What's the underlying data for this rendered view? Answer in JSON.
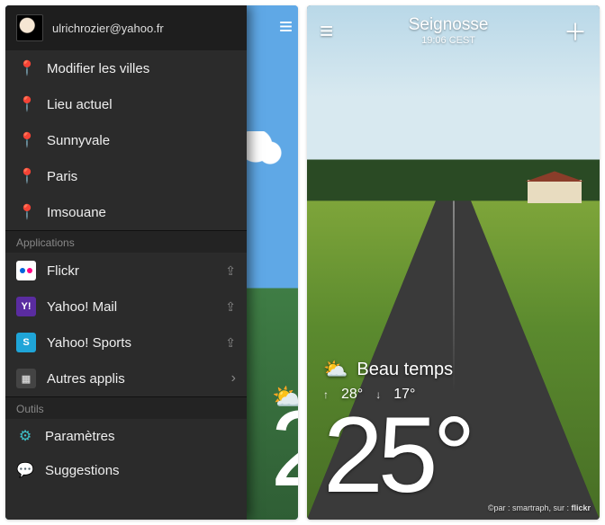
{
  "user": {
    "email": "ulrichrozier@yahoo.fr"
  },
  "locations": {
    "edit_label": "Modifier les villes",
    "items": [
      {
        "label": "Lieu actuel"
      },
      {
        "label": "Sunnyvale"
      },
      {
        "label": "Paris"
      },
      {
        "label": "Imsouane"
      }
    ]
  },
  "sections": {
    "apps_header": "Applications",
    "tools_header": "Outils"
  },
  "apps": [
    {
      "label": "Flickr",
      "icon": "flickr",
      "trailing": "download"
    },
    {
      "label": "Yahoo! Mail",
      "icon": "ymail",
      "trailing": "download"
    },
    {
      "label": "Yahoo! Sports",
      "icon": "ysports",
      "trailing": "download"
    },
    {
      "label": "Autres applis",
      "icon": "more",
      "trailing": "chevron"
    }
  ],
  "tools": [
    {
      "label": "Paramètres",
      "icon": "gear"
    },
    {
      "label": "Suggestions",
      "icon": "chat"
    }
  ],
  "peek": {
    "big_temp": "2"
  },
  "weather": {
    "location": "Seignosse",
    "time": "19:06 CEST",
    "condition": "Beau temps",
    "high": "28°",
    "low": "17°",
    "current": "25°"
  },
  "credit": {
    "prefix": "©par : ",
    "author": "smartraph",
    "mid": ", sur : ",
    "service": "flickr"
  }
}
